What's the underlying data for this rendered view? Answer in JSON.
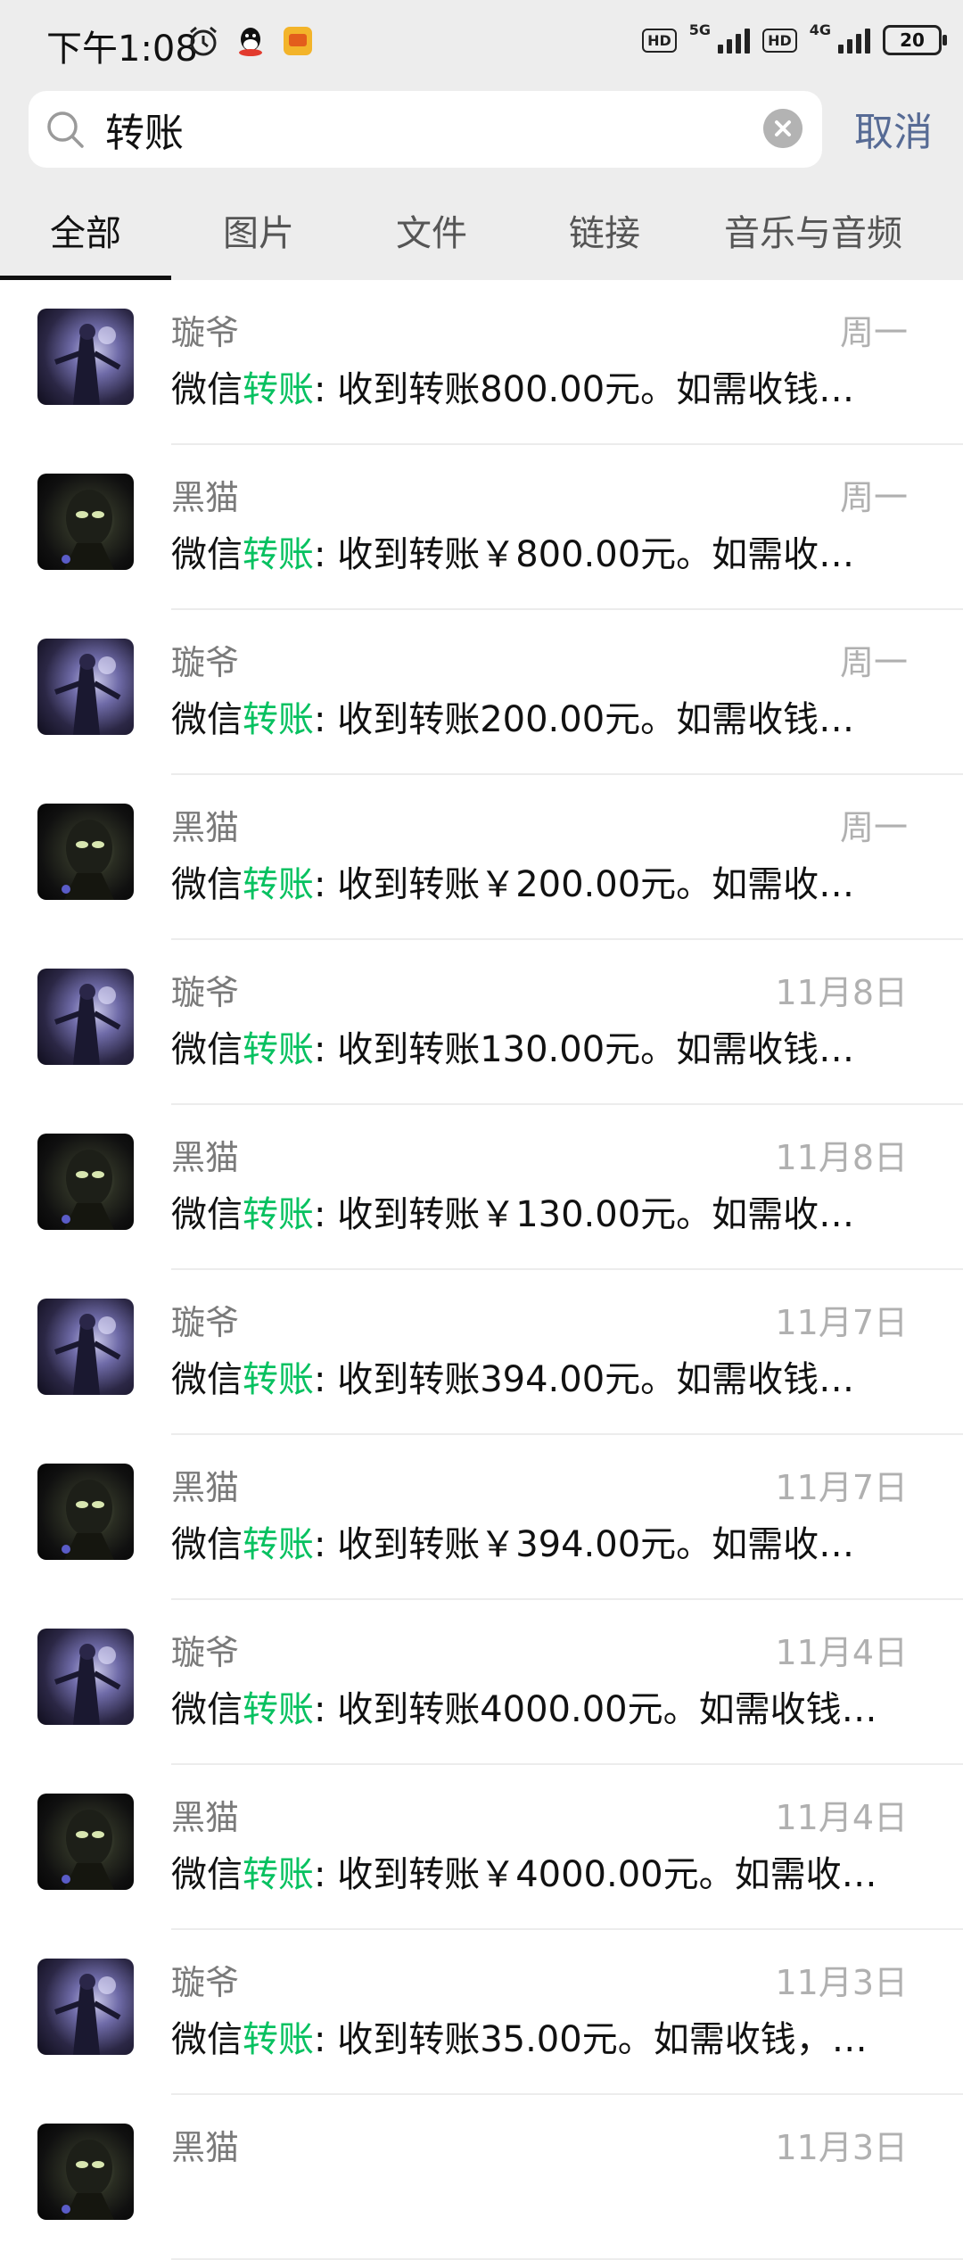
{
  "status_bar": {
    "time": "下午1:08",
    "hd_badge": "HD",
    "net1": "5G",
    "net2": "4G",
    "battery": "20",
    "icons": [
      "alarm-icon",
      "qq-icon",
      "app-icon",
      "hd-icon",
      "signal-icon",
      "battery-icon"
    ]
  },
  "search": {
    "query": "转账",
    "cancel_label": "取消"
  },
  "tabs": [
    {
      "label": "全部",
      "active": true
    },
    {
      "label": "图片"
    },
    {
      "label": "文件"
    },
    {
      "label": "链接"
    },
    {
      "label": "音乐与音频"
    }
  ],
  "colors": {
    "highlight": "#07c160",
    "cancel": "#576b95",
    "header_bg": "#ededed"
  },
  "results": [
    {
      "name": "璇爷",
      "date": "周一",
      "prefix": "微信",
      "keyword": "转账",
      "rest": ": 收到转账800.00元。如需收钱…",
      "avatar": "blue"
    },
    {
      "name": "黑猫",
      "date": "周一",
      "prefix": "微信",
      "keyword": "转账",
      "rest": ": 收到转账￥800.00元。如需收…",
      "avatar": "dark"
    },
    {
      "name": "璇爷",
      "date": "周一",
      "prefix": "微信",
      "keyword": "转账",
      "rest": ": 收到转账200.00元。如需收钱…",
      "avatar": "blue"
    },
    {
      "name": "黑猫",
      "date": "周一",
      "prefix": "微信",
      "keyword": "转账",
      "rest": ": 收到转账￥200.00元。如需收…",
      "avatar": "dark"
    },
    {
      "name": "璇爷",
      "date": "11月8日",
      "prefix": "微信",
      "keyword": "转账",
      "rest": ": 收到转账130.00元。如需收钱…",
      "avatar": "blue"
    },
    {
      "name": "黑猫",
      "date": "11月8日",
      "prefix": "微信",
      "keyword": "转账",
      "rest": ": 收到转账￥130.00元。如需收…",
      "avatar": "dark"
    },
    {
      "name": "璇爷",
      "date": "11月7日",
      "prefix": "微信",
      "keyword": "转账",
      "rest": ": 收到转账394.00元。如需收钱…",
      "avatar": "blue"
    },
    {
      "name": "黑猫",
      "date": "11月7日",
      "prefix": "微信",
      "keyword": "转账",
      "rest": ": 收到转账￥394.00元。如需收…",
      "avatar": "dark"
    },
    {
      "name": "璇爷",
      "date": "11月4日",
      "prefix": "微信",
      "keyword": "转账",
      "rest": ": 收到转账4000.00元。如需收钱…",
      "avatar": "blue"
    },
    {
      "name": "黑猫",
      "date": "11月4日",
      "prefix": "微信",
      "keyword": "转账",
      "rest": ": 收到转账￥4000.00元。如需收…",
      "avatar": "dark"
    },
    {
      "name": "璇爷",
      "date": "11月3日",
      "prefix": "微信",
      "keyword": "转账",
      "rest": ": 收到转账35.00元。如需收钱，…",
      "avatar": "blue"
    },
    {
      "name": "黑猫",
      "date": "11月3日",
      "prefix": "",
      "keyword": "",
      "rest": "",
      "avatar": "dark"
    }
  ]
}
